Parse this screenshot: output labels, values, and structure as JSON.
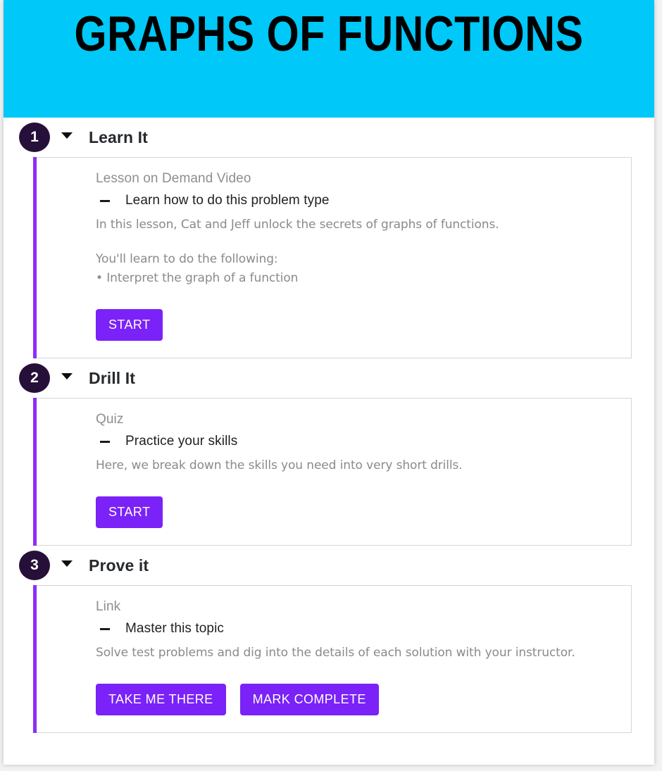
{
  "banner": {
    "title": "GRAPHS OF FUNCTIONS",
    "background_color": "#00c8f8",
    "title_color": "#000000"
  },
  "theme": {
    "accent_purple": "#7a22f7",
    "rail_purple": "#8c2ff5",
    "badge_dark": "#260f38",
    "muted_text": "#8a8a8f",
    "card_border": "#d6d6d6"
  },
  "sections": [
    {
      "number": "1",
      "title": "Learn It",
      "caret_icon": "chevron-down-icon",
      "kicker": "Lesson on Demand Video",
      "task": "Learn how to do this problem type",
      "description": "In this lesson, Cat and Jeff unlock the secrets of graphs of functions.",
      "learn_intro": "You'll learn to do the following:",
      "learn_items": [
        "• Interpret the graph of a function"
      ],
      "buttons": [
        "START"
      ]
    },
    {
      "number": "2",
      "title": "Drill It",
      "caret_icon": "chevron-down-icon",
      "kicker": "Quiz",
      "task": "Practice your skills",
      "description": "Here, we break down the skills you need into very short drills.",
      "learn_intro": "",
      "learn_items": [],
      "buttons": [
        "START"
      ]
    },
    {
      "number": "3",
      "title": "Prove it",
      "caret_icon": "chevron-down-icon",
      "kicker": "Link",
      "task": "Master this topic",
      "description": "Solve test problems and dig into the details of each solution with your instructor.",
      "learn_intro": "",
      "learn_items": [],
      "buttons": [
        "TAKE ME THERE",
        "MARK COMPLETE"
      ]
    }
  ]
}
